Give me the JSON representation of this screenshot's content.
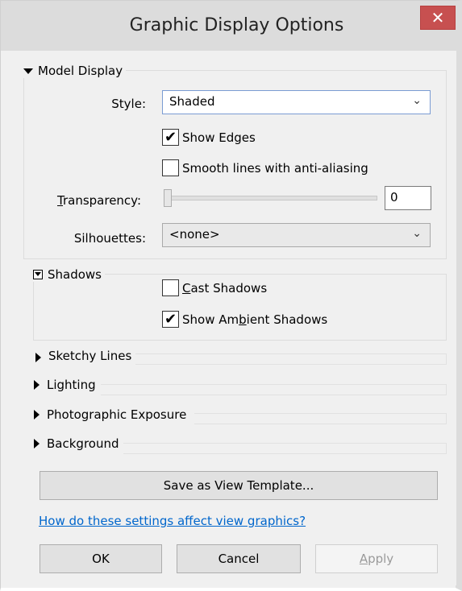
{
  "window": {
    "title": "Graphic Display Options",
    "close_glyph": "✕"
  },
  "model_display": {
    "header": "Model Display",
    "style_label": "Style:",
    "style_value": "Shaded",
    "show_edges_label": "Show Edges",
    "show_edges_checked": true,
    "smooth_lines_label": "Smooth lines with anti-aliasing",
    "smooth_lines_checked": false,
    "transparency_label_ak": "T",
    "transparency_label_rest": "ransparency:",
    "transparency_value": "0",
    "transparency_level": 0,
    "silhouettes_label": "Silhouettes:",
    "silhouettes_value": "<none>"
  },
  "shadows": {
    "header": "Shadows",
    "cast_ak": "C",
    "cast_rest": "ast Shadows",
    "cast_checked": false,
    "ambient_pre": "Show Am",
    "ambient_ak": "b",
    "ambient_post": "ient Shadows",
    "ambient_checked": true
  },
  "collapsed_sections": {
    "sketchy": "Sketchy Lines",
    "lighting": "Lighting",
    "exposure": "Photographic Exposure",
    "background": "Background"
  },
  "buttons": {
    "save_template": "Save as View Template...",
    "ok": "OK",
    "cancel": "Cancel",
    "apply_ak": "A",
    "apply_rest": "pply"
  },
  "help_link": "How do these settings affect view graphics?",
  "icons": {
    "check": "✔",
    "chevron": "⌄"
  }
}
